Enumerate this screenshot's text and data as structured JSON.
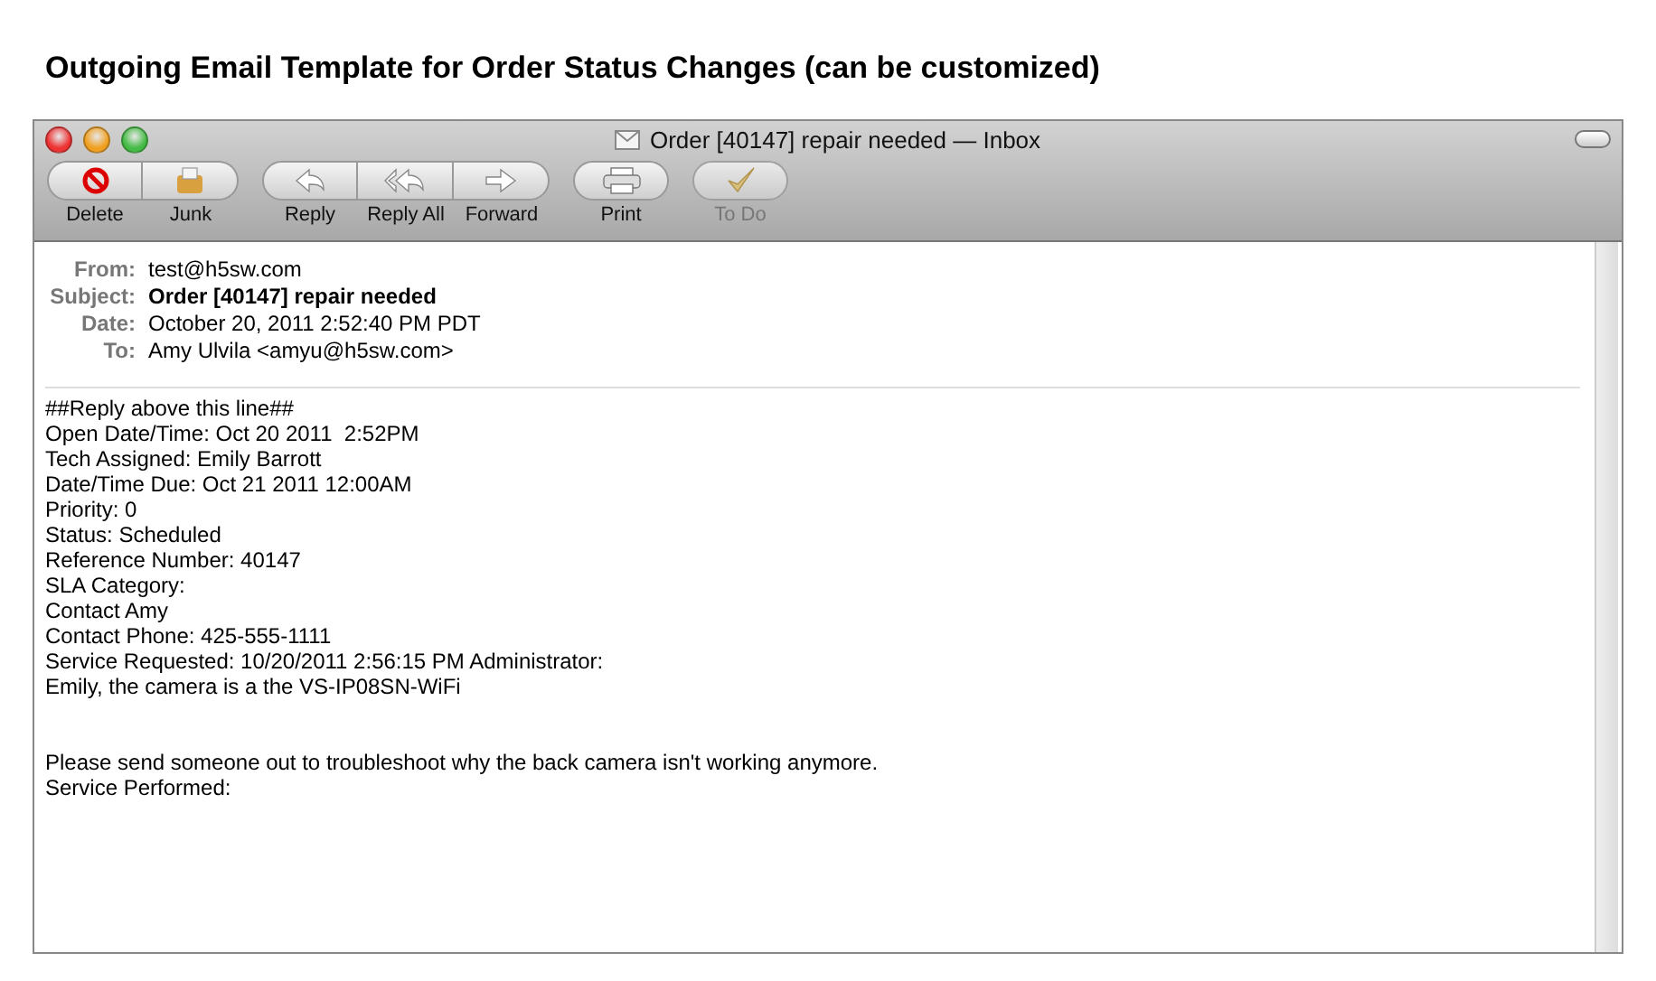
{
  "heading": "Outgoing Email Template for Order Status Changes (can be customized)",
  "window": {
    "title": "Order [40147] repair needed — Inbox"
  },
  "toolbar": [
    {
      "buttons": [
        {
          "label": "Delete",
          "kind": "delete",
          "disabled": false
        },
        {
          "label": "Junk",
          "kind": "junk",
          "disabled": false
        }
      ]
    },
    {
      "buttons": [
        {
          "label": "Reply",
          "kind": "reply",
          "disabled": false
        },
        {
          "label": "Reply All",
          "kind": "replyall",
          "disabled": false
        },
        {
          "label": "Forward",
          "kind": "forward",
          "disabled": false
        }
      ]
    },
    {
      "buttons": [
        {
          "label": "Print",
          "kind": "print",
          "disabled": false
        }
      ]
    },
    {
      "buttons": [
        {
          "label": "To Do",
          "kind": "todo",
          "disabled": true
        }
      ]
    }
  ],
  "headers": [
    {
      "label": "From:",
      "value": "test@h5sw.com",
      "bold": false
    },
    {
      "label": "Subject:",
      "value": "Order [40147] repair needed",
      "bold": true
    },
    {
      "label": "Date:",
      "value": "October 20, 2011 2:52:40 PM PDT",
      "bold": false
    },
    {
      "label": "To:",
      "value": "Amy Ulvila <amyu@h5sw.com>",
      "bold": false
    }
  ],
  "body": [
    {
      "lines": [
        "##Reply above this line##",
        "Open Date/Time: Oct 20 2011  2:52PM",
        "Tech Assigned: Emily Barrott",
        "Date/Time Due: Oct 21 2011 12:00AM",
        "Priority: 0",
        "Status: Scheduled",
        "Reference Number: 40147",
        "SLA Category:",
        "Contact Amy",
        "Contact Phone: 425-555-1111",
        "Service Requested: 10/20/2011 2:56:15 PM Administrator:",
        "Emily, the camera is a the VS-IP08SN-WiFi"
      ]
    },
    {
      "lines": [
        "Please send someone out to troubleshoot why the back camera isn't working anymore.",
        "Service Performed:"
      ]
    }
  ]
}
